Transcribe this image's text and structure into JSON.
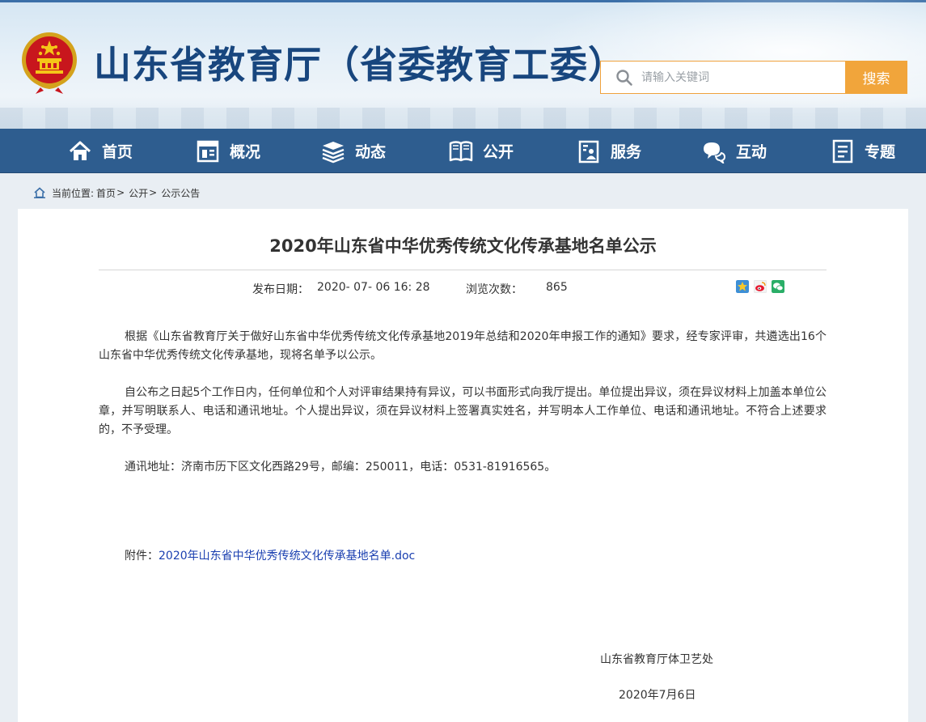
{
  "header": {
    "site_title": "山东省教育厅（省委教育工委）",
    "search_placeholder": "请输入关键词",
    "search_button": "搜索"
  },
  "nav": {
    "items": [
      {
        "label": "首页",
        "icon": "home-icon"
      },
      {
        "label": "概况",
        "icon": "overview-icon"
      },
      {
        "label": "动态",
        "icon": "news-icon"
      },
      {
        "label": "公开",
        "icon": "book-icon"
      },
      {
        "label": "服务",
        "icon": "service-icon"
      },
      {
        "label": "互动",
        "icon": "chat-icon"
      },
      {
        "label": "专题",
        "icon": "topic-icon"
      }
    ]
  },
  "breadcrumb": {
    "prefix": "当前位置:",
    "items": [
      "首页",
      "公开",
      "公示公告"
    ],
    "separator": ">"
  },
  "article": {
    "title": "2020年山东省中华优秀传统文化传承基地名单公示",
    "publish_label": "发布日期：",
    "publish_date": "2020- 07- 06 16: 28",
    "views_label": "浏览次数：",
    "views": "865",
    "paragraphs": [
      "根据《山东省教育厅关于做好山东省中华优秀传统文化传承基地2019年总结和2020年申报工作的通知》要求，经专家评审，共遴选出16个山东省中华优秀传统文化传承基地，现将名单予以公示。",
      "自公布之日起5个工作日内，任何单位和个人对评审结果持有异议，可以书面形式向我厅提出。单位提出异议，须在异议材料上加盖本单位公章，并写明联系人、电话和通讯地址。个人提出异议，须在异议材料上签署真实姓名，并写明本人工作单位、电话和通讯地址。不符合上述要求的，不予受理。",
      "通讯地址：济南市历下区文化西路29号，邮编：250011，电话：0531-81916565。"
    ],
    "attachment_label": "附件：",
    "attachment_link": "2020年山东省中华优秀传统文化传承基地名单.doc",
    "signature": "山东省教育厅体卫艺处",
    "sign_date": "2020年7月6日"
  },
  "colors": {
    "nav_bg": "#2e5d8f",
    "title_blue": "#18467e",
    "search_orange": "#f1a53b",
    "link_blue": "#1a3fb0"
  }
}
